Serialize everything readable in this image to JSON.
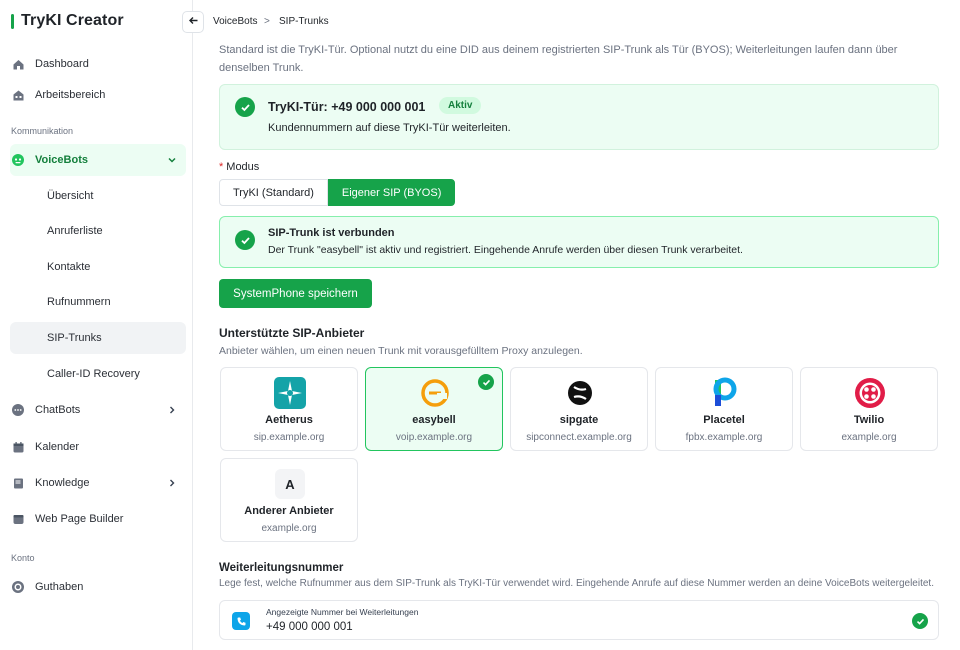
{
  "app": {
    "title": "TryKI Creator"
  },
  "sidebar": {
    "items": [
      {
        "label": "Dashboard",
        "icon": "home-icon"
      },
      {
        "label": "Arbeitsbereich",
        "icon": "building-icon"
      }
    ],
    "section_kommunikation": "Kommunikation",
    "voicebots": {
      "label": "VoiceBots",
      "icon": "voicebot-icon"
    },
    "voicebot_sub": [
      {
        "label": "Übersicht"
      },
      {
        "label": "Anruferliste"
      },
      {
        "label": "Kontakte"
      },
      {
        "label": "Rufnummern"
      },
      {
        "label": "SIP-Trunks"
      },
      {
        "label": "Caller-ID Recovery"
      }
    ],
    "more": [
      {
        "label": "ChatBots",
        "icon": "chat-icon"
      },
      {
        "label": "Kalender",
        "icon": "calendar-icon"
      },
      {
        "label": "Knowledge",
        "icon": "book-icon"
      },
      {
        "label": "Web Page Builder",
        "icon": "web-icon"
      }
    ],
    "section_konto": "Konto",
    "guthaben": {
      "label": "Guthaben",
      "icon": "coin-icon"
    }
  },
  "breadcrumb": {
    "parent": "VoiceBots",
    "separator": ">",
    "current": "SIP-Trunks"
  },
  "intro_text": "Standard ist die TryKI-Tür. Optional nutzt du eine DID aus deinem registrierten SIP-Trunk als Tür (BYOS); Weiterleitungen laufen dann über denselben Trunk.",
  "tryki_door": {
    "title": "TryKI-Tür: +49 000 000 001",
    "badge": "Aktiv",
    "subtitle": "Kundennummern auf diese TryKI-Tür weiterleiten."
  },
  "mode": {
    "label": "Modus",
    "required_mark": "*",
    "options": [
      "TryKI (Standard)",
      "Eigener SIP (BYOS)"
    ],
    "selected": "Eigener SIP (BYOS)"
  },
  "trunk_status": {
    "title": "SIP-Trunk ist verbunden",
    "message": "Der Trunk \"easybell\" ist aktiv und registriert. Eingehende Anrufe werden über diesen Trunk verarbeitet."
  },
  "save_button": "SystemPhone speichern",
  "providers": {
    "heading": "Unterstützte SIP-Anbieter",
    "description": "Anbieter wählen, um einen neuen Trunk mit vorausgefülltem Proxy anzulegen.",
    "items": [
      {
        "name": "Aetherus",
        "domain": "sip.example.org",
        "icon": "aetherus-logo-icon",
        "selected": false
      },
      {
        "name": "easybell",
        "domain": "voip.example.org",
        "icon": "easybell-logo-icon",
        "selected": true
      },
      {
        "name": "sipgate",
        "domain": "sipconnect.example.org",
        "icon": "sipgate-logo-icon",
        "selected": false
      },
      {
        "name": "Placetel",
        "domain": "fpbx.example.org",
        "icon": "placetel-logo-icon",
        "selected": false
      },
      {
        "name": "Twilio",
        "domain": "example.org",
        "icon": "twilio-logo-icon",
        "selected": false
      },
      {
        "name": "Anderer Anbieter",
        "domain": "example.org",
        "icon": "letter-a-icon",
        "letter": "A",
        "selected": false
      }
    ]
  },
  "forwarding": {
    "heading": "Weiterleitungsnummer",
    "description": "Lege fest, welche Rufnummer aus dem SIP-Trunk als TryKI-Tür verwendet wird. Eingehende Anrufe auf diese Nummer werden an deine VoiceBots weitergeleitet.",
    "field_label": "Angezeigte Nummer bei Weiterleitungen",
    "number": "+49 000 000 001"
  },
  "colors": {
    "accent": "#16a34a",
    "accent_bg": "#ecfdf3",
    "required": "#dc2626"
  }
}
